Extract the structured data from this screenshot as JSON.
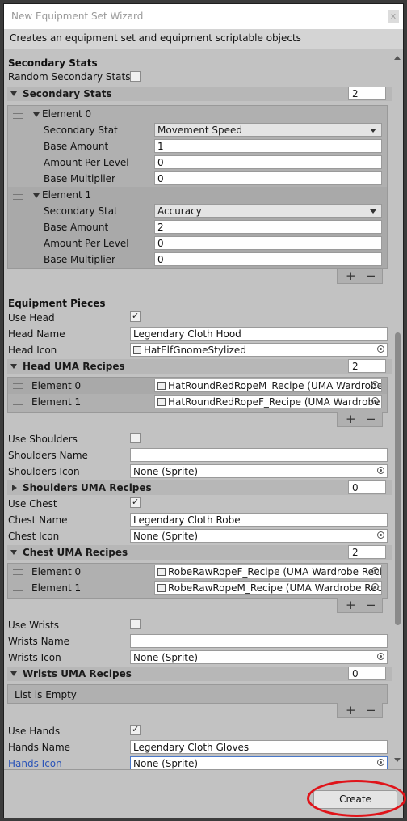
{
  "window": {
    "title": "New Equipment Set Wizard",
    "close_label": "x",
    "description": "Creates an equipment set and equipment scriptable objects"
  },
  "secondary_stats": {
    "section_title": "Secondary Stats",
    "random_label": "Random Secondary Stats",
    "random_checked": false,
    "list_title": "Secondary Stats",
    "count": "2",
    "field_labels": {
      "stat": "Secondary Stat",
      "base": "Base Amount",
      "per_level": "Amount Per Level",
      "mult": "Base Multiplier"
    },
    "elements": [
      {
        "label": "Element 0",
        "stat": "Movement Speed",
        "base": "1",
        "per_level": "0",
        "mult": "0"
      },
      {
        "label": "Element 1",
        "stat": "Accuracy",
        "base": "2",
        "per_level": "0",
        "mult": "0"
      }
    ]
  },
  "list_buttons": {
    "add": "+",
    "remove": "−"
  },
  "equipment": {
    "section_title": "Equipment Pieces",
    "head": {
      "use_label": "Use Head",
      "use_checked": true,
      "name_label": "Head Name",
      "name_value": "Legendary Cloth Hood",
      "icon_label": "Head Icon",
      "icon_value": "HatElfGnomeStylized",
      "recipes_title": "Head UMA Recipes",
      "recipes_count": "2",
      "recipes": [
        {
          "label": "Element 0",
          "value": "HatRoundRedRopeM_Recipe (UMA Wardrobe Recipe)"
        },
        {
          "label": "Element 1",
          "value": "HatRoundRedRopeF_Recipe (UMA Wardrobe Recipe)"
        }
      ]
    },
    "shoulders": {
      "use_label": "Use Shoulders",
      "use_checked": false,
      "name_label": "Shoulders Name",
      "name_value": "",
      "icon_label": "Shoulders Icon",
      "icon_value": "None (Sprite)",
      "recipes_title": "Shoulders UMA Recipes",
      "recipes_count": "0"
    },
    "chest": {
      "use_label": "Use Chest",
      "use_checked": true,
      "name_label": "Chest Name",
      "name_value": "Legendary Cloth Robe",
      "icon_label": "Chest Icon",
      "icon_value": "None (Sprite)",
      "recipes_title": "Chest UMA Recipes",
      "recipes_count": "2",
      "recipes": [
        {
          "label": "Element 0",
          "value": "RobeRawRopeF_Recipe (UMA Wardrobe Recipe)"
        },
        {
          "label": "Element 1",
          "value": "RobeRawRopeM_Recipe (UMA Wardrobe Recipe)"
        }
      ]
    },
    "wrists": {
      "use_label": "Use Wrists",
      "use_checked": false,
      "name_label": "Wrists Name",
      "name_value": "",
      "icon_label": "Wrists Icon",
      "icon_value": "None (Sprite)",
      "recipes_title": "Wrists UMA Recipes",
      "recipes_count": "0",
      "empty_text": "List is Empty"
    },
    "hands": {
      "use_label": "Use Hands",
      "use_checked": true,
      "name_label": "Hands Name",
      "name_value": "Legendary Cloth Gloves",
      "icon_label": "Hands Icon",
      "icon_value": "None (Sprite)"
    }
  },
  "create_button": "Create",
  "colors": {
    "highlight_circle": "#e0141a",
    "link_label": "#2c55b8"
  }
}
